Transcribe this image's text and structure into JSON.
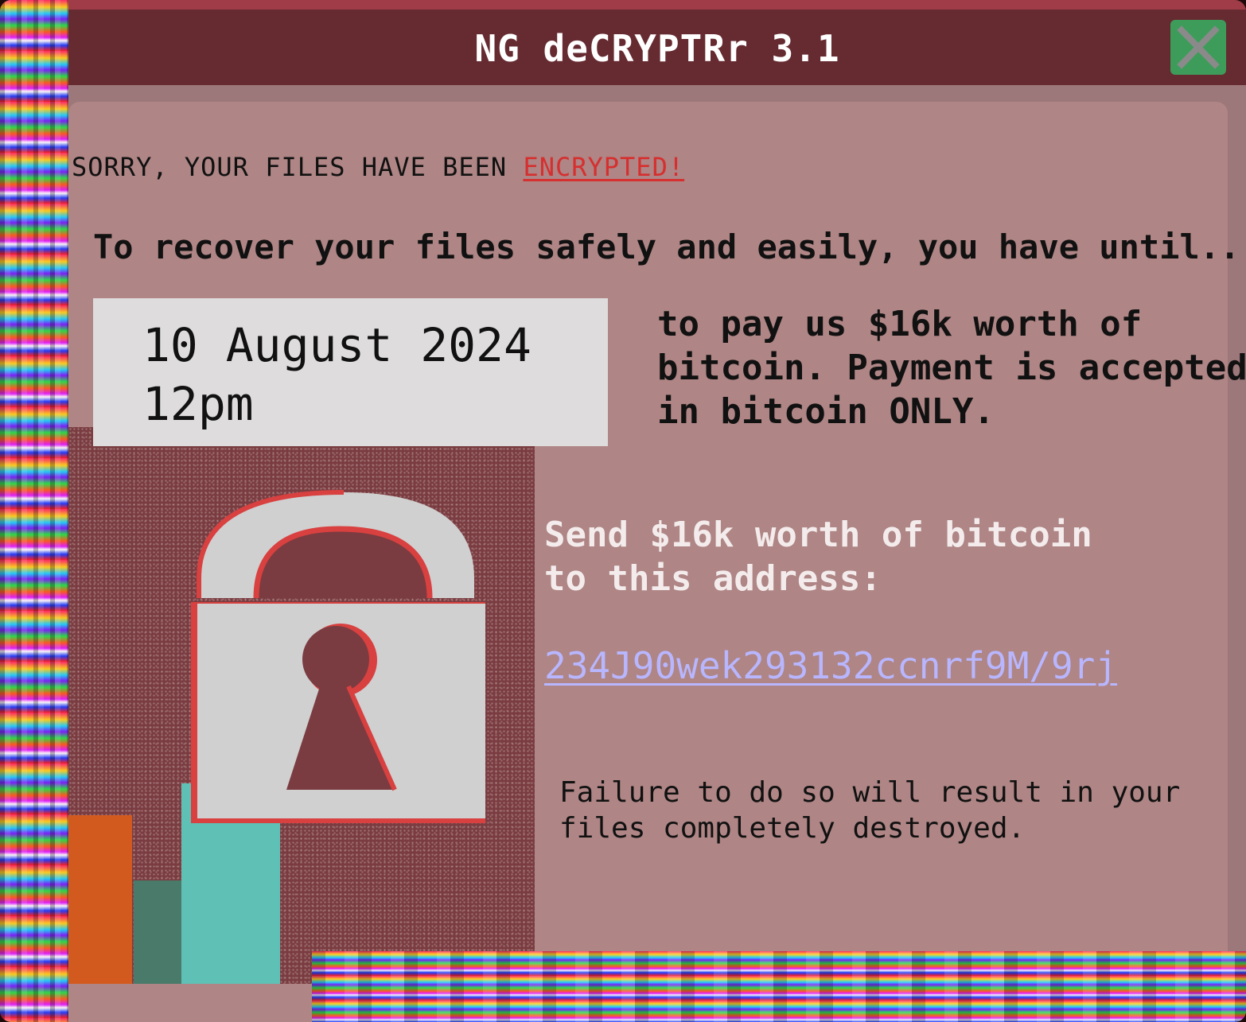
{
  "window": {
    "title": "NG deCRYPTRr 3.1",
    "close_icon": "close-x-icon"
  },
  "notice": {
    "sorry_text": "SORRY, YOUR FILES HAVE BEEN ",
    "encrypted_text": "ENCRYPTED!",
    "recover_text": "To recover your files safely and easily, you have until..."
  },
  "deadline": {
    "date": "10 August 2024",
    "time": "12pm"
  },
  "payment": {
    "line1": "to pay us $16k worth of",
    "line2": "bitcoin. Payment is accepted",
    "line3": "in bitcoin ONLY."
  },
  "send": {
    "line1": "Send $16k worth of bitcoin",
    "line2": "to this address:",
    "address": "234J90wek293132ccnrf9M/9rj"
  },
  "warning": {
    "line1": "Failure to do so will result in your",
    "line2": "files completely destroyed."
  },
  "colors": {
    "title_bar": "#662b31",
    "content_bg": "#af8585",
    "encrypted_red": "#d62f2f",
    "address_link": "#b8b6ff",
    "close_button": "#3e9c5b"
  },
  "icons": {
    "lock": "padlock-icon"
  }
}
